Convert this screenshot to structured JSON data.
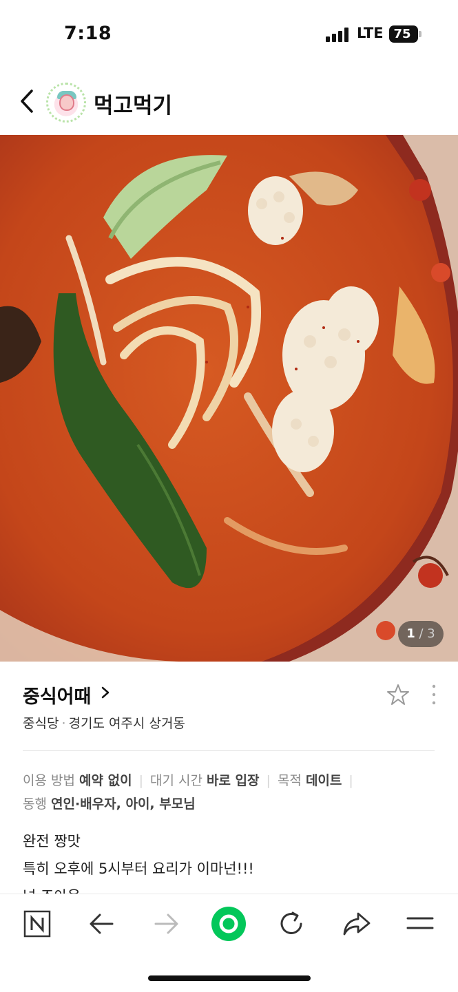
{
  "status": {
    "time": "7:18",
    "network": "LTE",
    "battery": "75"
  },
  "header": {
    "title": "먹고먹기",
    "back_icon": "chevron-left-icon",
    "avatar_icon": "profile-avatar"
  },
  "photo": {
    "description_icon": "food-photo",
    "current": "1",
    "total": "3"
  },
  "place": {
    "name": "중식어때",
    "category": "중식당",
    "address": "경기도 여주시 상거동"
  },
  "tags": [
    {
      "key": "이용 방법",
      "value": "예약 없이"
    },
    {
      "key": "대기 시간",
      "value": "바로 입장"
    },
    {
      "key": "목적",
      "value": "데이트"
    },
    {
      "key": "동행",
      "value": "연인·배우자, 아이, 부모님"
    }
  ],
  "review": [
    "완전 짱맛",
    "특히 오후에 5시부터 요리가 이마넌!!!",
    "넘 조아용"
  ],
  "toolbar": {
    "items": [
      "naver-logo-icon",
      "back-arrow-icon",
      "forward-arrow-icon",
      "green-dot-icon",
      "refresh-icon",
      "share-icon",
      "menu-icon"
    ]
  },
  "colors": {
    "accent_green": "#03c75a",
    "soup": "#c84a1b"
  }
}
